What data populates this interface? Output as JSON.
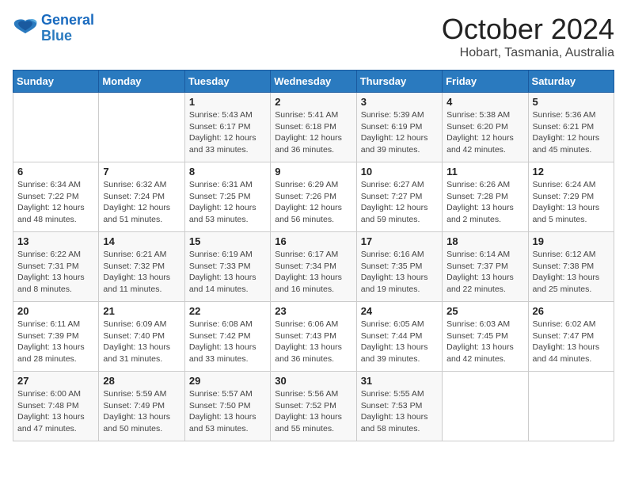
{
  "logo": {
    "line1": "General",
    "line2": "Blue"
  },
  "title": "October 2024",
  "subtitle": "Hobart, Tasmania, Australia",
  "days_header": [
    "Sunday",
    "Monday",
    "Tuesday",
    "Wednesday",
    "Thursday",
    "Friday",
    "Saturday"
  ],
  "weeks": [
    [
      {
        "day": "",
        "info": ""
      },
      {
        "day": "",
        "info": ""
      },
      {
        "day": "1",
        "info": "Sunrise: 5:43 AM\nSunset: 6:17 PM\nDaylight: 12 hours and 33 minutes."
      },
      {
        "day": "2",
        "info": "Sunrise: 5:41 AM\nSunset: 6:18 PM\nDaylight: 12 hours and 36 minutes."
      },
      {
        "day": "3",
        "info": "Sunrise: 5:39 AM\nSunset: 6:19 PM\nDaylight: 12 hours and 39 minutes."
      },
      {
        "day": "4",
        "info": "Sunrise: 5:38 AM\nSunset: 6:20 PM\nDaylight: 12 hours and 42 minutes."
      },
      {
        "day": "5",
        "info": "Sunrise: 5:36 AM\nSunset: 6:21 PM\nDaylight: 12 hours and 45 minutes."
      }
    ],
    [
      {
        "day": "6",
        "info": "Sunrise: 6:34 AM\nSunset: 7:22 PM\nDaylight: 12 hours and 48 minutes."
      },
      {
        "day": "7",
        "info": "Sunrise: 6:32 AM\nSunset: 7:24 PM\nDaylight: 12 hours and 51 minutes."
      },
      {
        "day": "8",
        "info": "Sunrise: 6:31 AM\nSunset: 7:25 PM\nDaylight: 12 hours and 53 minutes."
      },
      {
        "day": "9",
        "info": "Sunrise: 6:29 AM\nSunset: 7:26 PM\nDaylight: 12 hours and 56 minutes."
      },
      {
        "day": "10",
        "info": "Sunrise: 6:27 AM\nSunset: 7:27 PM\nDaylight: 12 hours and 59 minutes."
      },
      {
        "day": "11",
        "info": "Sunrise: 6:26 AM\nSunset: 7:28 PM\nDaylight: 13 hours and 2 minutes."
      },
      {
        "day": "12",
        "info": "Sunrise: 6:24 AM\nSunset: 7:29 PM\nDaylight: 13 hours and 5 minutes."
      }
    ],
    [
      {
        "day": "13",
        "info": "Sunrise: 6:22 AM\nSunset: 7:31 PM\nDaylight: 13 hours and 8 minutes."
      },
      {
        "day": "14",
        "info": "Sunrise: 6:21 AM\nSunset: 7:32 PM\nDaylight: 13 hours and 11 minutes."
      },
      {
        "day": "15",
        "info": "Sunrise: 6:19 AM\nSunset: 7:33 PM\nDaylight: 13 hours and 14 minutes."
      },
      {
        "day": "16",
        "info": "Sunrise: 6:17 AM\nSunset: 7:34 PM\nDaylight: 13 hours and 16 minutes."
      },
      {
        "day": "17",
        "info": "Sunrise: 6:16 AM\nSunset: 7:35 PM\nDaylight: 13 hours and 19 minutes."
      },
      {
        "day": "18",
        "info": "Sunrise: 6:14 AM\nSunset: 7:37 PM\nDaylight: 13 hours and 22 minutes."
      },
      {
        "day": "19",
        "info": "Sunrise: 6:12 AM\nSunset: 7:38 PM\nDaylight: 13 hours and 25 minutes."
      }
    ],
    [
      {
        "day": "20",
        "info": "Sunrise: 6:11 AM\nSunset: 7:39 PM\nDaylight: 13 hours and 28 minutes."
      },
      {
        "day": "21",
        "info": "Sunrise: 6:09 AM\nSunset: 7:40 PM\nDaylight: 13 hours and 31 minutes."
      },
      {
        "day": "22",
        "info": "Sunrise: 6:08 AM\nSunset: 7:42 PM\nDaylight: 13 hours and 33 minutes."
      },
      {
        "day": "23",
        "info": "Sunrise: 6:06 AM\nSunset: 7:43 PM\nDaylight: 13 hours and 36 minutes."
      },
      {
        "day": "24",
        "info": "Sunrise: 6:05 AM\nSunset: 7:44 PM\nDaylight: 13 hours and 39 minutes."
      },
      {
        "day": "25",
        "info": "Sunrise: 6:03 AM\nSunset: 7:45 PM\nDaylight: 13 hours and 42 minutes."
      },
      {
        "day": "26",
        "info": "Sunrise: 6:02 AM\nSunset: 7:47 PM\nDaylight: 13 hours and 44 minutes."
      }
    ],
    [
      {
        "day": "27",
        "info": "Sunrise: 6:00 AM\nSunset: 7:48 PM\nDaylight: 13 hours and 47 minutes."
      },
      {
        "day": "28",
        "info": "Sunrise: 5:59 AM\nSunset: 7:49 PM\nDaylight: 13 hours and 50 minutes."
      },
      {
        "day": "29",
        "info": "Sunrise: 5:57 AM\nSunset: 7:50 PM\nDaylight: 13 hours and 53 minutes."
      },
      {
        "day": "30",
        "info": "Sunrise: 5:56 AM\nSunset: 7:52 PM\nDaylight: 13 hours and 55 minutes."
      },
      {
        "day": "31",
        "info": "Sunrise: 5:55 AM\nSunset: 7:53 PM\nDaylight: 13 hours and 58 minutes."
      },
      {
        "day": "",
        "info": ""
      },
      {
        "day": "",
        "info": ""
      }
    ]
  ]
}
